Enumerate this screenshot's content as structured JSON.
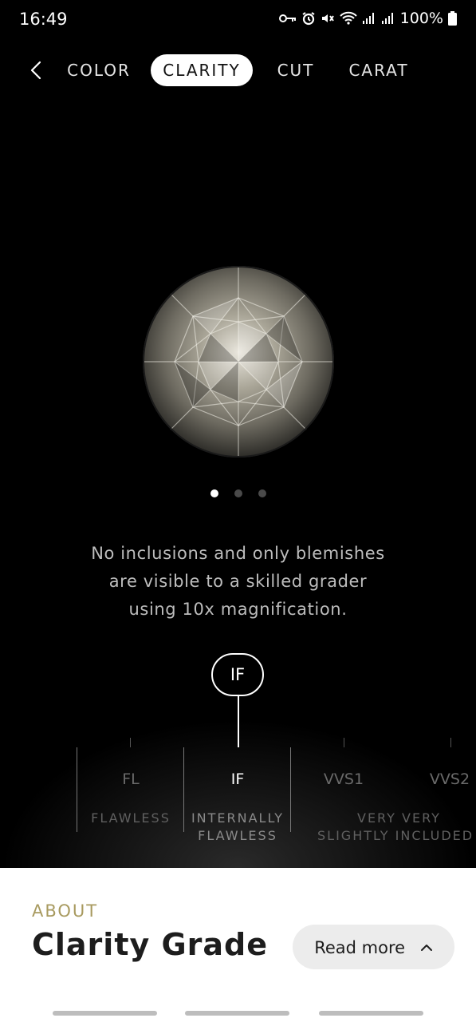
{
  "status_bar": {
    "time": "16:49",
    "battery": "100%",
    "icons": [
      "key-icon",
      "alarm-icon",
      "mute-icon",
      "wifi-icon",
      "signal-icon",
      "signal-icon",
      "battery-icon"
    ]
  },
  "nav": {
    "tabs": [
      {
        "label": "COLOR"
      },
      {
        "label": "CLARITY"
      },
      {
        "label": "CUT"
      },
      {
        "label": "CARAT"
      }
    ],
    "active_tab": "CLARITY"
  },
  "carousel": {
    "pages": 3,
    "active_page": 1
  },
  "description": {
    "line1": "No inclusions and only blemishes",
    "line2": "are visible to a skilled grader",
    "line3": "using 10x magnification."
  },
  "selected_grade": "IF",
  "scale": {
    "grades": [
      {
        "code": "FL",
        "name_line1": "FLAWLESS",
        "name_line2": ""
      },
      {
        "code": "IF",
        "name_line1": "INTERNALLY",
        "name_line2": "FLAWLESS"
      },
      {
        "code": "VVS1",
        "name_line1": "VERY VERY",
        "name_line2": "SLIGHTLY INCLUDED"
      },
      {
        "code": "VVS2",
        "name_line1": "",
        "name_line2": ""
      }
    ]
  },
  "about": {
    "kicker": "ABOUT",
    "title": "Clarity Grade",
    "read_more_label": "Read more"
  },
  "colors": {
    "background": "#000000",
    "active_tab_bg": "#ffffff",
    "accent_gold": "#a89a5f",
    "card_bg": "#ffffff",
    "button_bg": "#ececec"
  }
}
